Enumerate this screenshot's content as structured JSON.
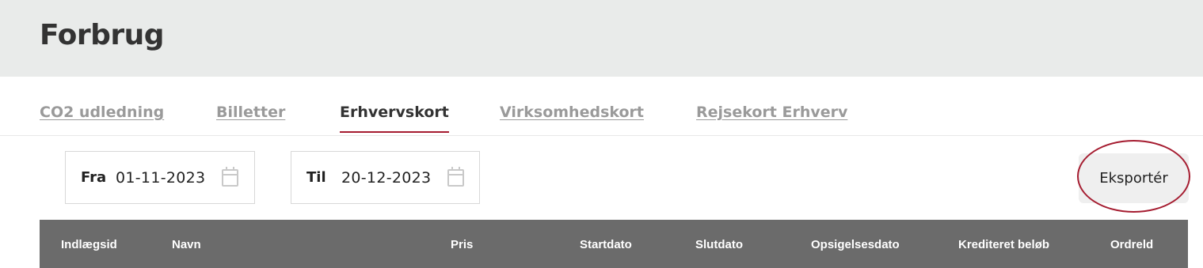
{
  "header": {
    "title": "Forbrug"
  },
  "tabs": [
    {
      "label": "CO2 udledning",
      "active": false
    },
    {
      "label": "Billetter",
      "active": false
    },
    {
      "label": "Erhvervskort",
      "active": true
    },
    {
      "label": "Virksomhedskort",
      "active": false
    },
    {
      "label": "Rejsekort Erhverv",
      "active": false
    }
  ],
  "filters": {
    "from": {
      "label": "Fra",
      "value": "01-11-2023",
      "icon": "calendar-icon"
    },
    "to": {
      "label": "Til",
      "value": "20-12-2023",
      "icon": "calendar-icon"
    }
  },
  "export": {
    "label": "Eksportér"
  },
  "table": {
    "columns": [
      "Indlægsid",
      "Navn",
      "Pris",
      "Startdato",
      "Slutdato",
      "Opsigelsesdato",
      "Krediteret beløb",
      "Ordreld"
    ]
  },
  "colors": {
    "accent": "#a51c30",
    "header_bg": "#e9ebea",
    "table_header_bg": "#6b6b6b"
  }
}
